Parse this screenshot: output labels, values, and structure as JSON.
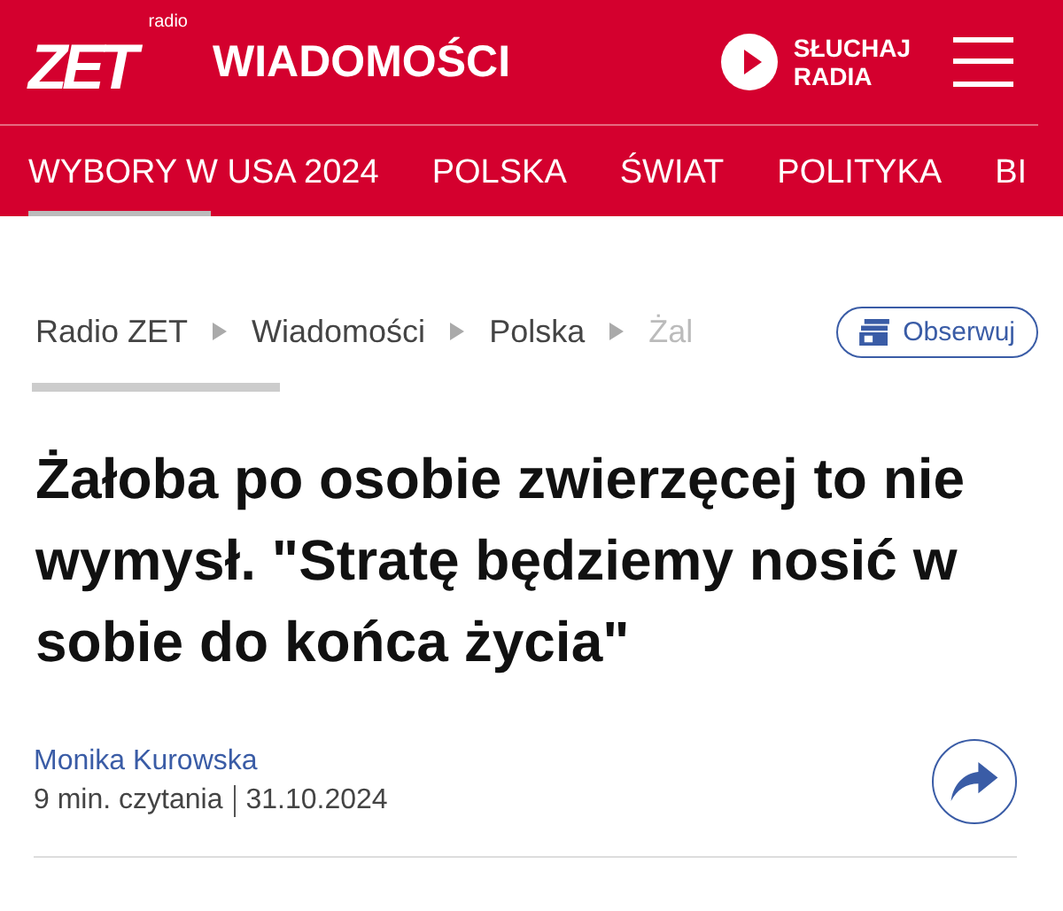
{
  "header": {
    "logo_small": "radio",
    "logo": "ZET",
    "section": "WIADOMOŚCI",
    "listen": [
      "SŁUCHAJ",
      "RADIA"
    ]
  },
  "nav": [
    "WYBORY W USA 2024",
    "POLSKA",
    "ŚWIAT",
    "POLITYKA",
    "BI"
  ],
  "breadcrumbs": [
    {
      "label": "Radio ZET",
      "current": false
    },
    {
      "label": "Wiadomości",
      "current": false
    },
    {
      "label": "Polska",
      "current": false
    },
    {
      "label": "Żal",
      "current": true
    }
  ],
  "follow_button": "Obserwuj",
  "headline": "Żałoba po osobie zwierzęcej to nie wymysł. \"Stratę będziemy nosić w sobie do końca życia\"",
  "author": "Monika Kurowska",
  "reading_time": "9 min. czytania",
  "date": "31.10.2024"
}
